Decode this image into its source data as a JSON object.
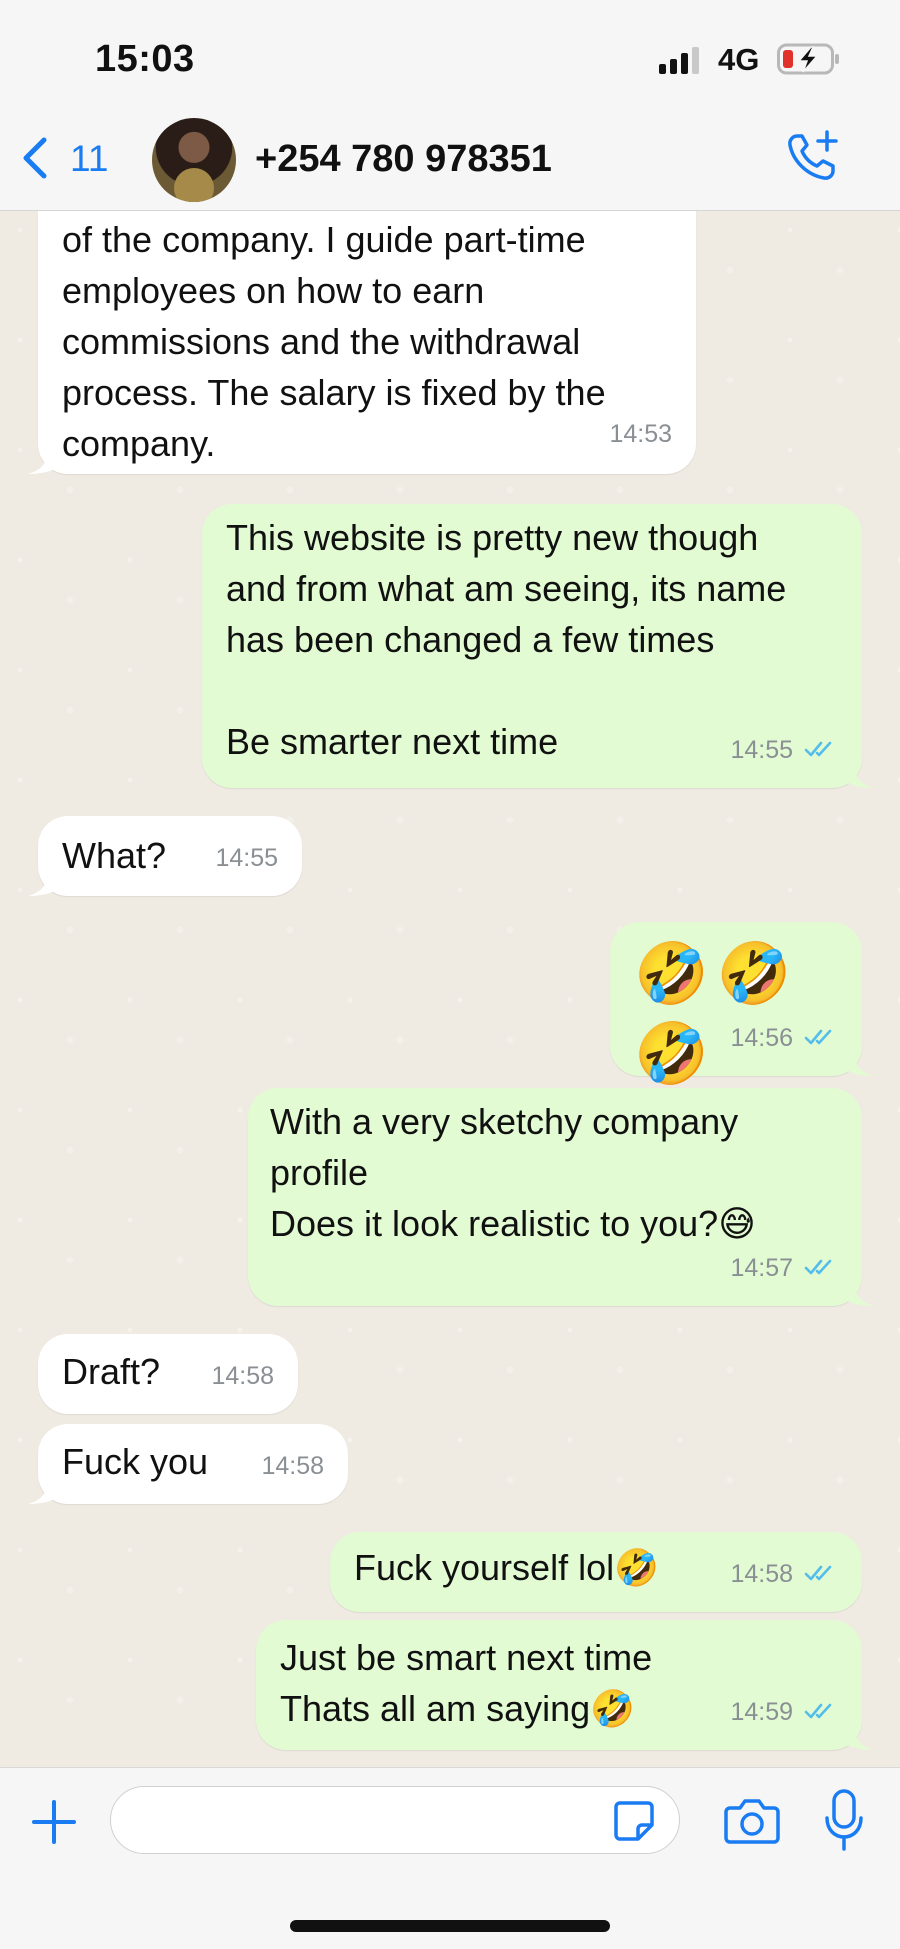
{
  "status_bar": {
    "time": "15:03",
    "network": "4G",
    "signal_icon": "signal-bars-icon",
    "battery_icon": "battery-charging-low-icon"
  },
  "header": {
    "back_count": "11",
    "contact": "+254 780 978351",
    "icons": [
      "chevron-left-icon",
      "avatar",
      "add-call-icon"
    ]
  },
  "colors": {
    "accent": "#1a7cf2",
    "incoming_bubble": "#ffffff",
    "outgoing_bubble": "#e2fbd3",
    "chat_background": "#efeae2",
    "read_ticks": "#53bdeb",
    "timestamp": "#8a8f94"
  },
  "messages": [
    {
      "direction": "in",
      "text": "of the company. I guide part-time\nemployees on how to earn\ncommissions and the withdrawal\nprocess. The salary is fixed by the\ncompany.",
      "time": "14:53"
    },
    {
      "direction": "out",
      "text": "This website is pretty new though\nand from what am seeing, its name\nhas been changed a few times\n\nBe smarter next time",
      "time": "14:55",
      "status": "read"
    },
    {
      "direction": "in",
      "text": "What?",
      "time": "14:55"
    },
    {
      "direction": "out",
      "text": "🤣🤣🤣",
      "time": "14:56",
      "status": "read"
    },
    {
      "direction": "out",
      "text": "With a very sketchy company\nprofile\nDoes it look realistic to you?😅",
      "time": "14:57",
      "status": "read"
    },
    {
      "direction": "in",
      "text": "Draft?",
      "time": "14:58"
    },
    {
      "direction": "in",
      "text": "Fuck you",
      "time": "14:58"
    },
    {
      "direction": "out",
      "text": "Fuck yourself lol🤣",
      "time": "14:58",
      "status": "read"
    },
    {
      "direction": "out",
      "text": "Just be smart next time\nThats all am saying🤣",
      "time": "14:59",
      "status": "read"
    }
  ],
  "composer": {
    "value": "",
    "placeholder": "",
    "icons": [
      "plus-icon",
      "sticker-icon",
      "camera-icon",
      "microphone-icon"
    ]
  }
}
